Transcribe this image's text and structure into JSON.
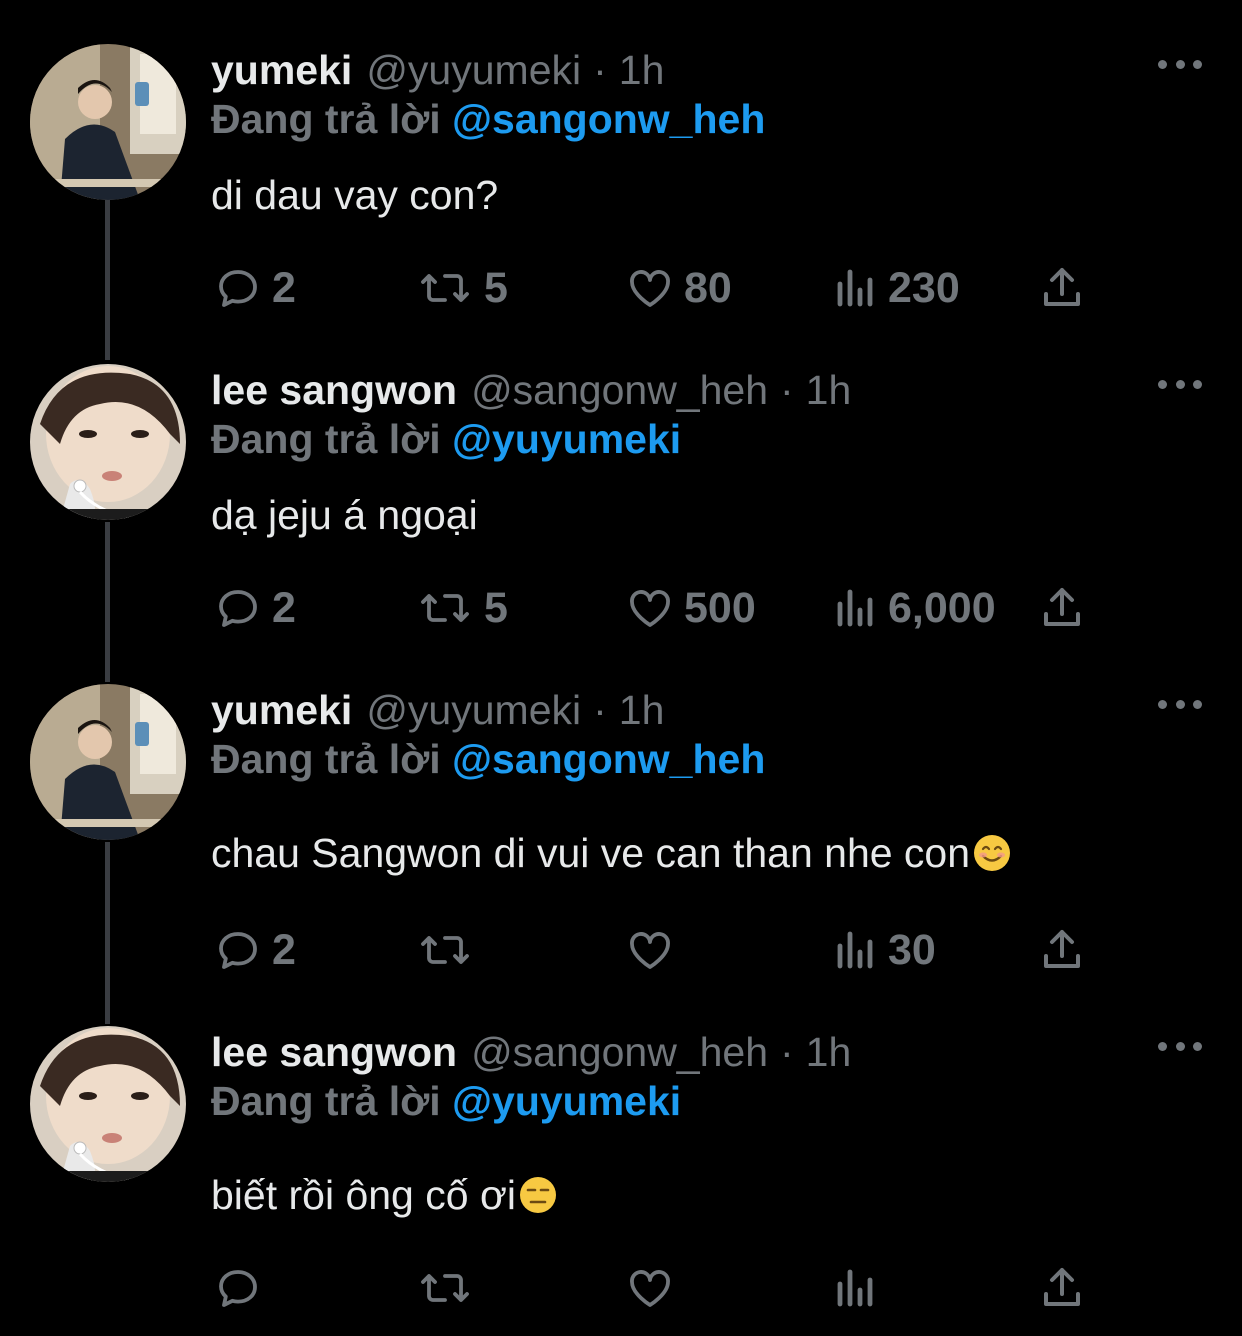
{
  "colors": {
    "background": "#000000",
    "text": "#e7e9ea",
    "muted": "#71767b",
    "mention": "#1d9bf0"
  },
  "tweets": [
    {
      "name": "yumeki",
      "handle": "@yuyumeki",
      "dot": "·",
      "time": "1h",
      "reply_label": "Đang trả lời",
      "reply_mention": "@sangonw_heh",
      "text": "di dau vay con?",
      "emoji": "",
      "stats": {
        "replies": "2",
        "retweets": "5",
        "likes": "80",
        "views": "230"
      },
      "avatar_icon": "avatar-yumeki"
    },
    {
      "name": "lee sangwon",
      "handle": "@sangonw_heh",
      "dot": "·",
      "time": "1h",
      "reply_label": "Đang trả lời",
      "reply_mention": "@yuyumeki",
      "text": "dạ jeju á ngoại",
      "emoji": "",
      "stats": {
        "replies": "2",
        "retweets": "5",
        "likes": "500",
        "views": "6,000"
      },
      "avatar_icon": "avatar-sangwon"
    },
    {
      "name": "yumeki",
      "handle": "@yuyumeki",
      "dot": "·",
      "time": "1h",
      "reply_label": "Đang trả lời",
      "reply_mention": "@sangonw_heh",
      "text": "chau Sangwon di vui ve can than nhe con",
      "emoji": "smiling-face",
      "stats": {
        "replies": "2",
        "retweets": "",
        "likes": "",
        "views": "30"
      },
      "avatar_icon": "avatar-yumeki"
    },
    {
      "name": "lee sangwon",
      "handle": "@sangonw_heh",
      "dot": "·",
      "time": "1h",
      "reply_label": "Đang trả lời",
      "reply_mention": "@yuyumeki",
      "text": "biết rồi ông cố ơi",
      "emoji": "expressionless-face",
      "stats": {
        "replies": "",
        "retweets": "",
        "likes": "",
        "views": ""
      },
      "avatar_icon": "avatar-sangwon"
    }
  ]
}
